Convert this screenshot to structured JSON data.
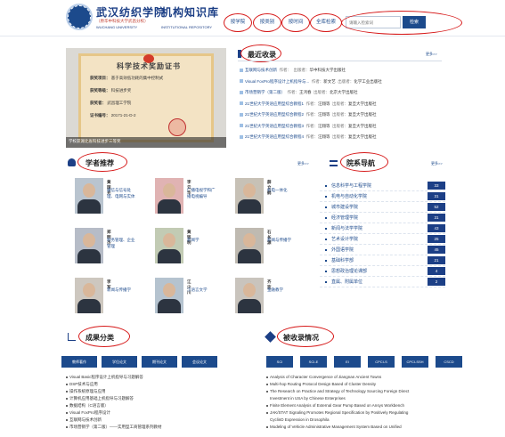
{
  "header": {
    "name_cn": "武汉纺织学院",
    "title_cn": "机构知识库",
    "subtitle": "（原华中科技大学武昌分校）",
    "name_en": "WUCHANG UNIVERSITY",
    "title_en": "INSTITUTIONAL REPOSITORY",
    "nav": [
      "按学院",
      "按类别",
      "按时间",
      "全库检索"
    ],
    "search_placeholder": "请输入检索词",
    "search_button": "检索"
  },
  "certificate": {
    "heading": "科学技术奖励证书",
    "lines": [
      "获奖项目：",
      "获奖等级：",
      "获奖者：",
      "证书编号："
    ],
    "line_values": [
      "基于高效低功耗的集中控制式",
      "科技进步奖",
      "武昌理工学院",
      "20171-21-D-2"
    ],
    "caption": "学校获湖北省科技进步三等奖"
  },
  "recent": {
    "title": "最近收录",
    "more": "更多>>",
    "items": [
      {
        "title": "互联网与技术创新",
        "author_label": "作者：",
        "author": "",
        "pub_label": "出版者：",
        "pub": "华中科技大学出版社"
      },
      {
        "title": "Visual FoxPro程序设计上机指导与...",
        "author_label": "作者：",
        "author": "新文艺",
        "pub_label": "出版者：",
        "pub": "化学工业出版社"
      },
      {
        "title": "市场营销学（第二版）",
        "author_label": "作者：",
        "author": "王鸿春",
        "pub_label": "出版者：",
        "pub": "北京大学出版社"
      },
      {
        "title": "21世纪大学英语应用型综合教程1",
        "author_label": "作者：",
        "author": "汪翔等",
        "pub_label": "出版者：",
        "pub": "复旦大学出版社"
      },
      {
        "title": "21世纪大学英语应用型综合教程2",
        "author_label": "作者：",
        "author": "汪翔等",
        "pub_label": "出版者：",
        "pub": "复旦大学出版社"
      },
      {
        "title": "21世纪大学英语应用型综合教程3",
        "author_label": "作者：",
        "author": "汪翔等",
        "pub_label": "出版者：",
        "pub": "复旦大学出版社"
      },
      {
        "title": "21世纪大学英语应用型综合教程4",
        "author_label": "作者：",
        "author": "汪翔等",
        "pub_label": "出版者：",
        "pub": "复旦大学出版社"
      }
    ]
  },
  "scholars": {
    "title": "学者推荐",
    "more": "更多>>",
    "people": [
      {
        "name": "黄国光",
        "desc": "通信与信号处理、电网与实体"
      },
      {
        "name": "李云华",
        "desc": "广播电视学和广播电视编导"
      },
      {
        "name": "薛立鹤",
        "desc": "机电一体化"
      },
      {
        "name": "郑明杰",
        "desc": "财务管理、企业管理"
      },
      {
        "name": "黄铭明",
        "desc": "新闻学"
      },
      {
        "name": "石长源",
        "desc": "新闻与传播学"
      },
      {
        "name": "李军",
        "desc": "新闻与传播学"
      },
      {
        "name": "江少川",
        "desc": "汉语言文学"
      },
      {
        "name": "齐欢",
        "desc": "金融教学"
      }
    ]
  },
  "departments": {
    "title": "院系导航",
    "more": "更多>>",
    "items": [
      {
        "name": "信息科学与工程学院",
        "count": "33"
      },
      {
        "name": "机电与自动化学院",
        "count": "31"
      },
      {
        "name": "城市建设学院",
        "count": "52"
      },
      {
        "name": "经济管理学院",
        "count": "31"
      },
      {
        "name": "新闻与法学学院",
        "count": "43"
      },
      {
        "name": "艺术设计学院",
        "count": "25"
      },
      {
        "name": "外国语学院",
        "count": "45"
      },
      {
        "name": "基础科学部",
        "count": "21"
      },
      {
        "name": "思想政治理论课部",
        "count": "4"
      },
      {
        "name": "直属、附属单位",
        "count": "2"
      }
    ]
  },
  "results": {
    "title": "成果分类",
    "tabs": [
      "教师著作",
      "学位论文",
      "期刊论文",
      "会议论文"
    ],
    "items": [
      "Visual Basic程序设计上机指导与习题解答",
      "DSP技术与应用",
      "操作系统原理与应用",
      "计算机应用基础上机指导与习题解答",
      "数据结构（C语言版）",
      "Visual FoxPro程序设计",
      "互联网与技术创新",
      "市场营销学（第二版）——实用型工商管理系列教材"
    ]
  },
  "indexed": {
    "title": "被收录情况",
    "tabs": [
      "SCI",
      "SCI-E",
      "EI",
      "CPCI-S",
      "CPCI-SSH",
      "CSCD"
    ],
    "items": [
      "Analysis of Character Convergence of Jiangnan Ancient Towns",
      "Multi-hop Routing Protocol Design Based of Cluster Density",
      "The Research on Practice and Strategy of Technology Sourcing Foreign Direct",
      "Investment in USA by Chinese Enterprises",
      "Finite Element Analysis of External Gear Pump Based on Ansys Workbench",
      "JAK/STAT Signaling Promotes Regional Specification by Positively Regulating",
      "CyclinD Expression in Drosophila",
      "Modeling of Vehicle Administrative Management System Based on Unified"
    ]
  },
  "colors": {
    "primary": "#1c4a8c",
    "annotation": "#d61818",
    "badge": "#1c3f86"
  }
}
